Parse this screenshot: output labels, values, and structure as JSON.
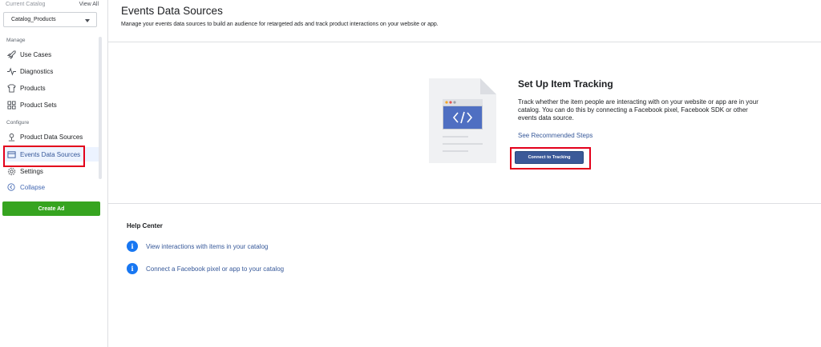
{
  "sidebar": {
    "current_catalog_label": "Current Catalog",
    "view_all_label": "View All",
    "catalog_value": "Catalog_Products",
    "manage_label": "Manage",
    "configure_label": "Configure",
    "items": [
      {
        "label": "Use Cases",
        "icon": "rocket-icon"
      },
      {
        "label": "Diagnostics",
        "icon": "pulse-icon"
      },
      {
        "label": "Products",
        "icon": "shirt-icon"
      },
      {
        "label": "Product Sets",
        "icon": "grid-icon"
      },
      {
        "label": "Product Data Sources",
        "icon": "upload-icon"
      },
      {
        "label": "Events Data Sources",
        "icon": "events-icon",
        "active": true
      },
      {
        "label": "Settings",
        "icon": "gear-icon"
      },
      {
        "label": "Collapse",
        "icon": "chevron-left-icon"
      }
    ],
    "create_ad_label": "Create Ad"
  },
  "main": {
    "title": "Events Data Sources",
    "subtitle": "Manage your events data sources to build an audience for retargeted ads and track product interactions on your website or app.",
    "setup": {
      "title": "Set Up Item Tracking",
      "description": "Track whether the item people are interacting with on your website or app are in your catalog. You can do this by connecting a Facebook pixel, Facebook SDK or other events data source.",
      "link": "See Recommended Steps",
      "button": "Connect to Tracking"
    },
    "help": {
      "title": "Help Center",
      "items": [
        "View interactions with items in your catalog",
        "Connect a Facebook pixel or app to your catalog"
      ]
    }
  },
  "colors": {
    "accent": "#3b5998",
    "link": "#365899",
    "create_ad": "#36a420",
    "highlight": "#e3001b",
    "info": "#1877f2"
  }
}
